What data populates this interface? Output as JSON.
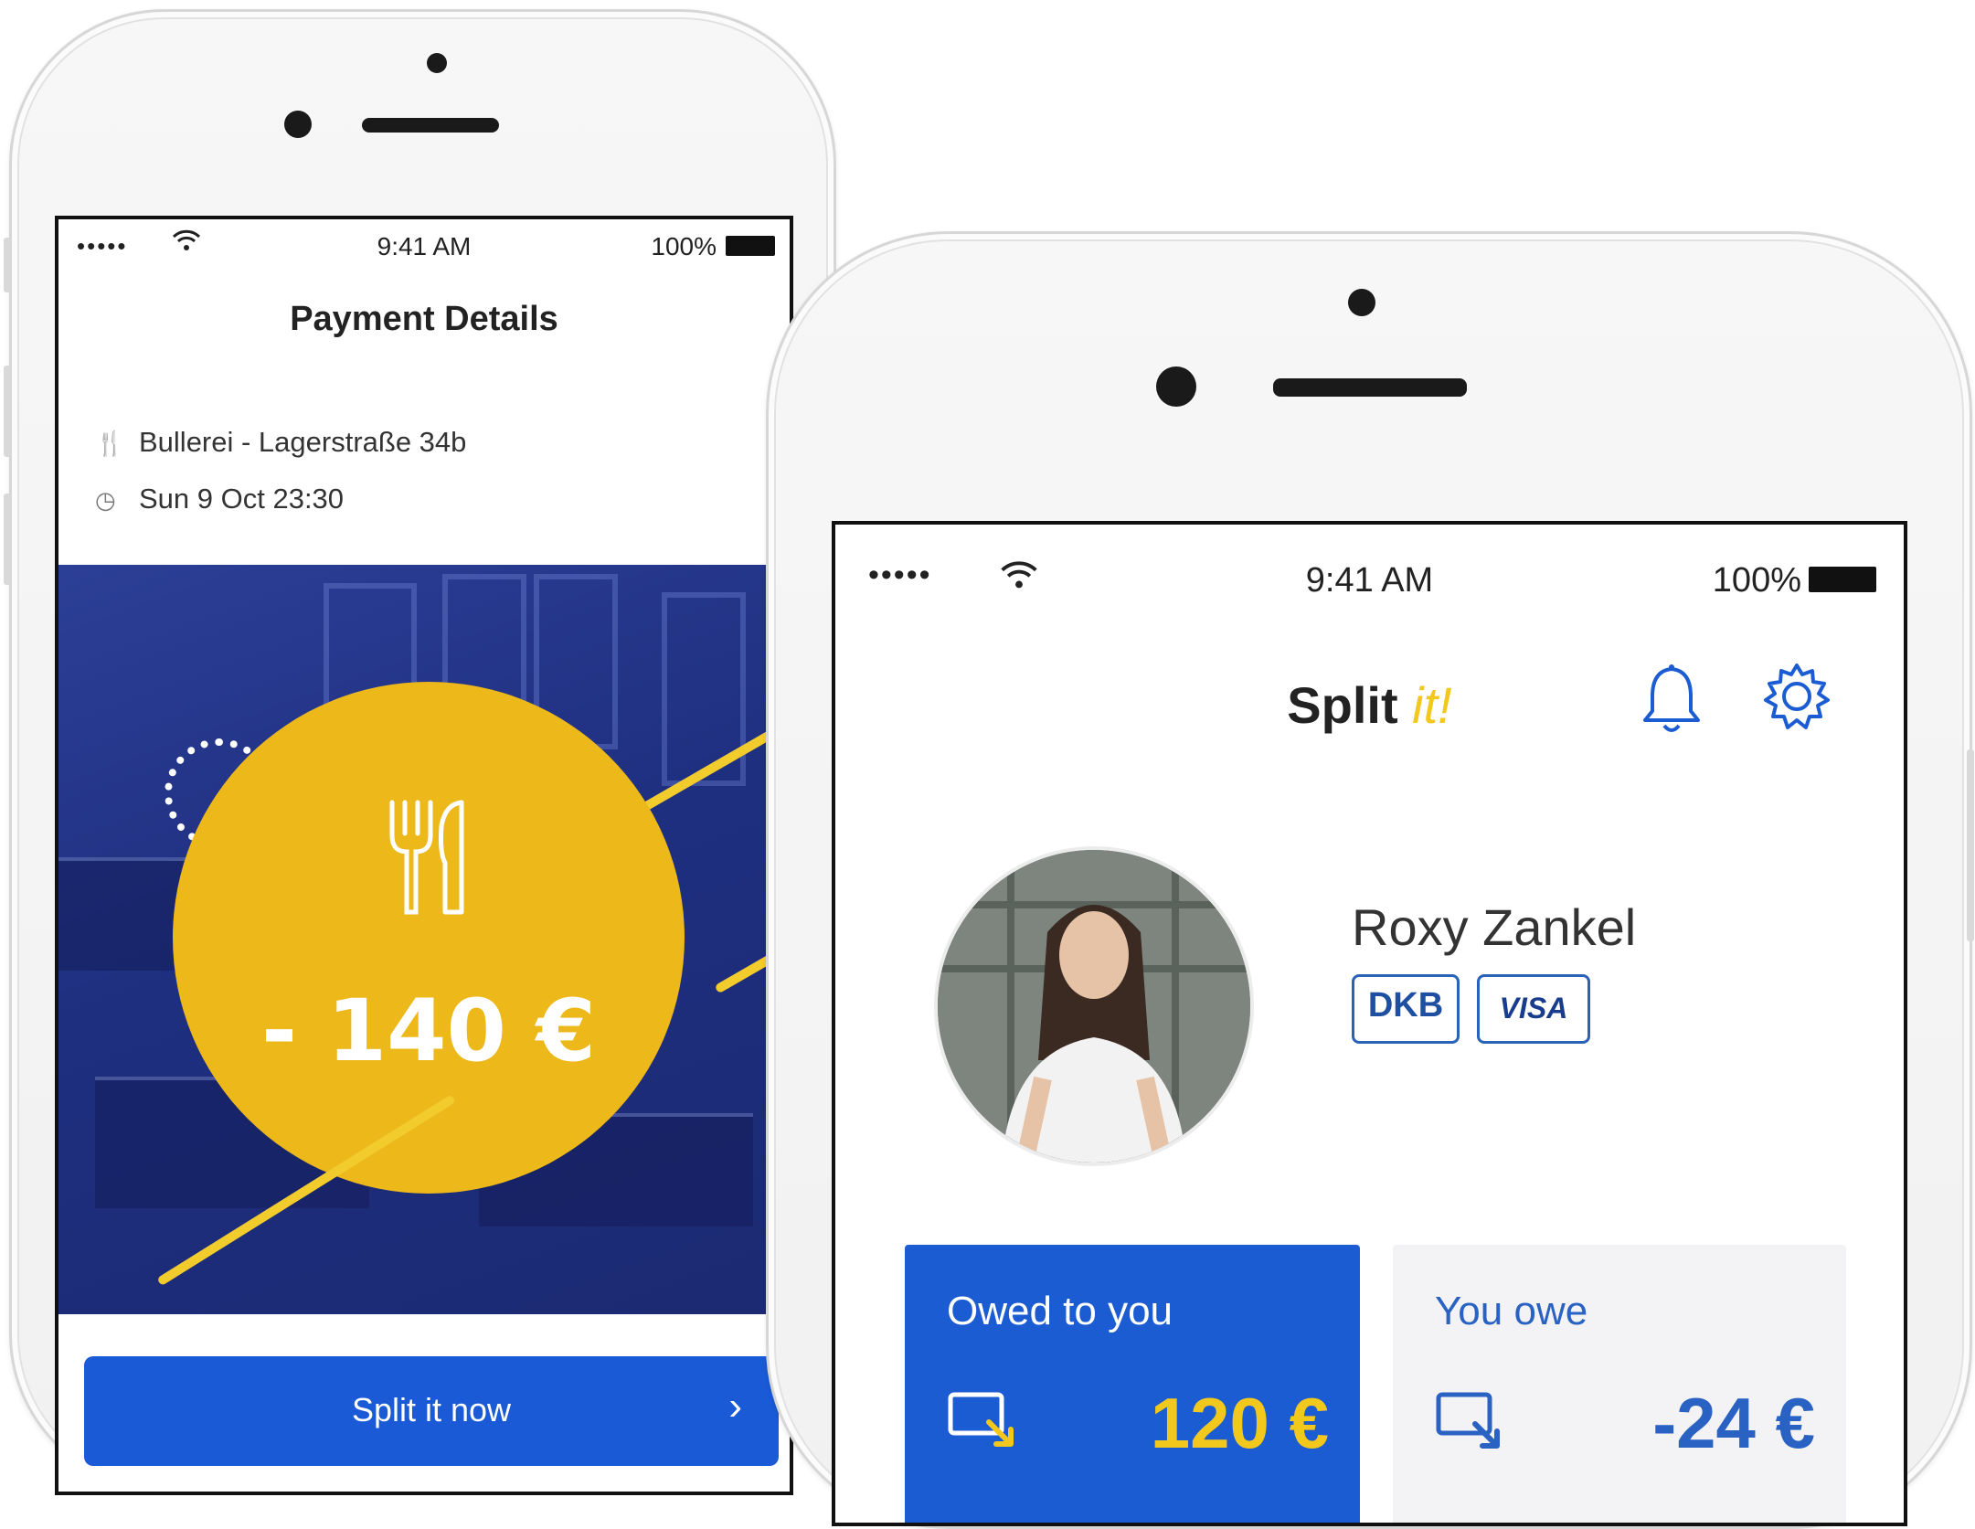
{
  "left_phone": {
    "status": {
      "signal": "•••••",
      "time": "9:41 AM",
      "battery": "100%"
    },
    "title": "Payment Details",
    "venue": {
      "icon": "fork-knife-icon",
      "text": "Bullerei - Lagerstraße 34b"
    },
    "datetime": {
      "icon": "clock-icon",
      "text": "Sun 9 Oct 23:30"
    },
    "hero": {
      "category_icon": "cutlery-icon",
      "amount": "- 140 €"
    },
    "split_button": {
      "label": "Split it now",
      "icon": "chevron-right-icon"
    }
  },
  "right_phone": {
    "status": {
      "signal": "•••••",
      "time": "9:41 AM",
      "battery": "100%"
    },
    "app_title": {
      "main": "Split ",
      "accent": "it!"
    },
    "icons": [
      "bell-icon",
      "gear-icon"
    ],
    "profile": {
      "name": "Roxy Zankel",
      "cards": [
        "DKB",
        "VISA"
      ]
    },
    "balances": [
      {
        "label": "Owed to you",
        "value": "120 €",
        "icon": "incoming-transfer-icon"
      },
      {
        "label": "You owe",
        "value": "-24 €",
        "icon": "outgoing-transfer-icon"
      }
    ]
  },
  "colors": {
    "primary_blue": "#1c5cd2",
    "accent_yellow": "#ecb81a",
    "hero_navy": "#1f2f80"
  }
}
